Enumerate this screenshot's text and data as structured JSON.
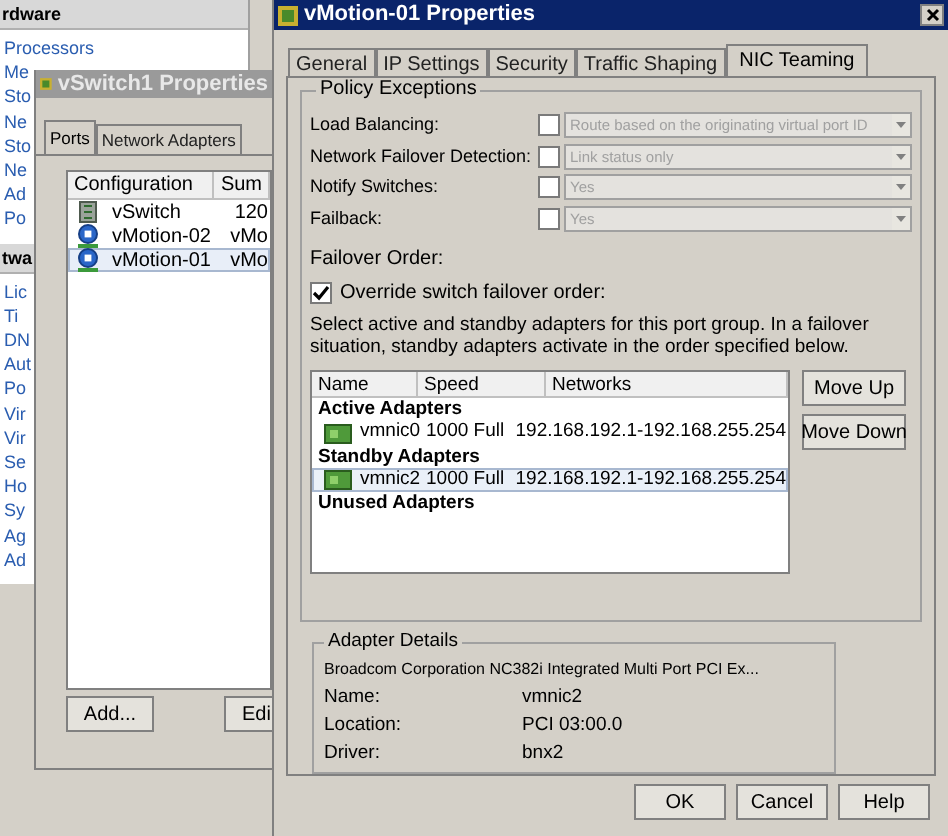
{
  "background_window": {
    "sections": [
      {
        "title": "rdware",
        "items": [
          "Processors",
          "Me",
          "Sto",
          "Ne",
          "Sto",
          "Ne",
          "Ad",
          "Po"
        ]
      },
      {
        "title": "twa",
        "items": [
          "Lic",
          "Ti",
          "DN",
          "Aut",
          "Po",
          "Vir",
          "Vir",
          "Se",
          "Ho",
          "Sy",
          "Ag",
          "Ad"
        ]
      }
    ]
  },
  "vswitch_window": {
    "title": "vSwitch1 Properties",
    "tabs": [
      {
        "label": "Ports",
        "selected": true
      },
      {
        "label": "Network Adapters",
        "selected": false
      }
    ],
    "table": {
      "columns": [
        "Configuration",
        "Sum"
      ],
      "rows": [
        {
          "kind": "switch",
          "cells": [
            "vSwitch",
            "120"
          ],
          "selected": false
        },
        {
          "kind": "port",
          "cells": [
            "vMotion-02",
            "vMo"
          ],
          "selected": false
        },
        {
          "kind": "port",
          "cells": [
            "vMotion-01",
            "vMo"
          ],
          "selected": true
        }
      ]
    },
    "buttons": [
      "Add...",
      "Edi"
    ]
  },
  "port_window": {
    "title": "vMotion-01 Properties",
    "tabs": [
      {
        "label": "General",
        "selected": false
      },
      {
        "label": "IP Settings",
        "selected": false
      },
      {
        "label": "Security",
        "selected": false
      },
      {
        "label": "Traffic Shaping",
        "selected": false
      },
      {
        "label": "NIC Teaming",
        "selected": true
      }
    ],
    "policy_exceptions": {
      "title": "Policy Exceptions",
      "rows": [
        {
          "label": "Load Balancing:",
          "checked": false,
          "value": "Route based on the originating virtual port ID",
          "disabled": true
        },
        {
          "label": "Network Failover Detection:",
          "checked": false,
          "value": "Link status only",
          "disabled": true
        },
        {
          "label": "Notify Switches:",
          "checked": false,
          "value": "Yes",
          "disabled": true
        },
        {
          "label": "Failback:",
          "checked": false,
          "value": "Yes",
          "disabled": true
        }
      ]
    },
    "failover": {
      "title": "Failover Order:",
      "override": {
        "label": "Override switch failover order:",
        "checked": true
      },
      "description": "Select active and standby adapters for this port group.  In a failover situation, standby adapters activate  in the order specified below.",
      "table": {
        "columns": [
          "Name",
          "Speed",
          "Networks"
        ],
        "groups": [
          {
            "title": "Active Adapters",
            "rows": [
              {
                "name": "vmnic0",
                "speed": "1000 Full",
                "networks": "192.168.192.1-192.168.255.254",
                "selected": false
              }
            ]
          },
          {
            "title": "Standby Adapters",
            "rows": [
              {
                "name": "vmnic2",
                "speed": "1000 Full",
                "networks": "192.168.192.1-192.168.255.254",
                "selected": true
              }
            ]
          },
          {
            "title": "Unused Adapters"
          }
        ]
      },
      "buttons": [
        "Move Up",
        "Move Down"
      ]
    },
    "adapter_details": {
      "title": "Adapter Details",
      "description": "Broadcom Corporation NC382i Integrated Multi Port PCI Ex...",
      "fields": [
        {
          "label": "Name:",
          "value": "vmnic2"
        },
        {
          "label": "Location:",
          "value": "PCI 03:00.0"
        },
        {
          "label": "Driver:",
          "value": "bnx2"
        }
      ]
    },
    "buttons": [
      "OK",
      "Cancel",
      "Help"
    ]
  }
}
